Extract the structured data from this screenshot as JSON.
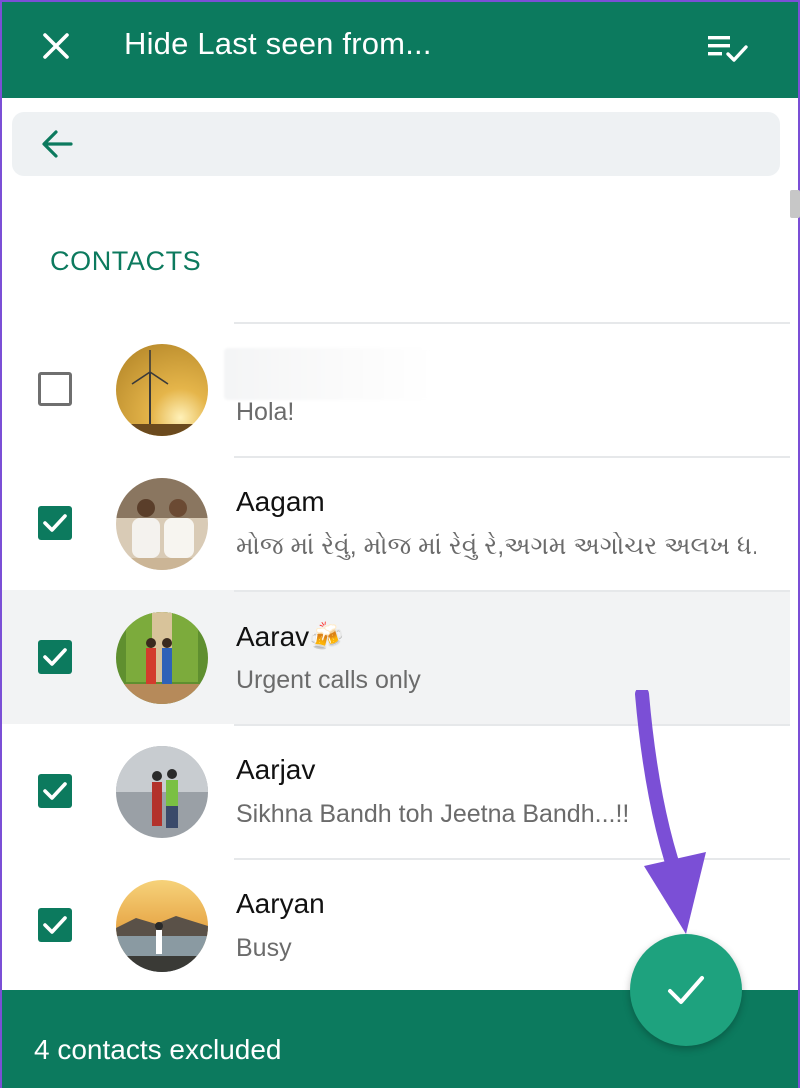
{
  "header": {
    "title": "Hide Last seen from...",
    "close_icon": "close-icon",
    "select_all_icon": "select-all-icon"
  },
  "search": {
    "back_icon": "arrow-left-icon"
  },
  "section": {
    "label": "CONTACTS"
  },
  "contacts": [
    {
      "name": "",
      "status": "Hola!",
      "checked": false
    },
    {
      "name": "Aagam",
      "status": "મોજ માં રેવું, મોજ માં રેવું રે,અગમ અગોચર અલખ ધ...",
      "checked": true
    },
    {
      "name": "Aarav🍻",
      "status": "Urgent calls only",
      "checked": true
    },
    {
      "name": "Aarjav",
      "status": "Sikhna Bandh toh Jeetna Bandh...!!",
      "checked": true
    },
    {
      "name": "Aaryan",
      "status": "Busy",
      "checked": true
    }
  ],
  "footer": {
    "count_text": "4 contacts excluded"
  },
  "fab": {
    "icon": "check-icon"
  },
  "colors": {
    "primary": "#0c7a5e",
    "fab": "#1ea27e",
    "annotation_arrow": "#7b4fd6"
  }
}
